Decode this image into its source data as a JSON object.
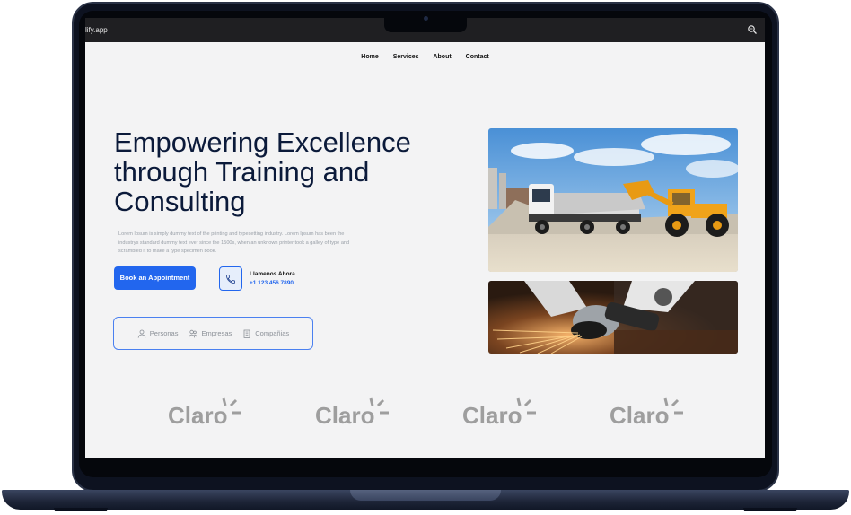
{
  "browser": {
    "url_fragment": "lify.app",
    "zoom_icon": "magnifier-icon"
  },
  "nav": {
    "items": [
      "Home",
      "Services",
      "About",
      "Contact"
    ]
  },
  "hero": {
    "title_line1": "Empowering Excellence",
    "title_line2": "through Training and",
    "title_line3": "Consulting",
    "description": "Lorem Ipsum is simply dummy text of the printing and typesetting industry. Lorem Ipsum has been the industrys standard dummy text ever since the 1500s, when an unknown printer took a galley of type and scrambled it to make a type specimen book."
  },
  "cta": {
    "book_label": "Book an Appointment",
    "phone_icon": "phone-icon",
    "call_label": "Llamenos Ahora",
    "call_number": "+1 123 456 7890"
  },
  "tabs": [
    {
      "label": "Personas",
      "icon": "person-icon"
    },
    {
      "label": "Empresas",
      "icon": "people-icon"
    },
    {
      "label": "Compañias",
      "icon": "building-icon"
    }
  ],
  "logos": [
    "Claro",
    "Claro",
    "Claro",
    "Claro"
  ],
  "colors": {
    "accent": "#2266ee",
    "heading": "#0b1a3a",
    "background": "#f3f3f4",
    "logo_gray": "#9e9e9e"
  }
}
